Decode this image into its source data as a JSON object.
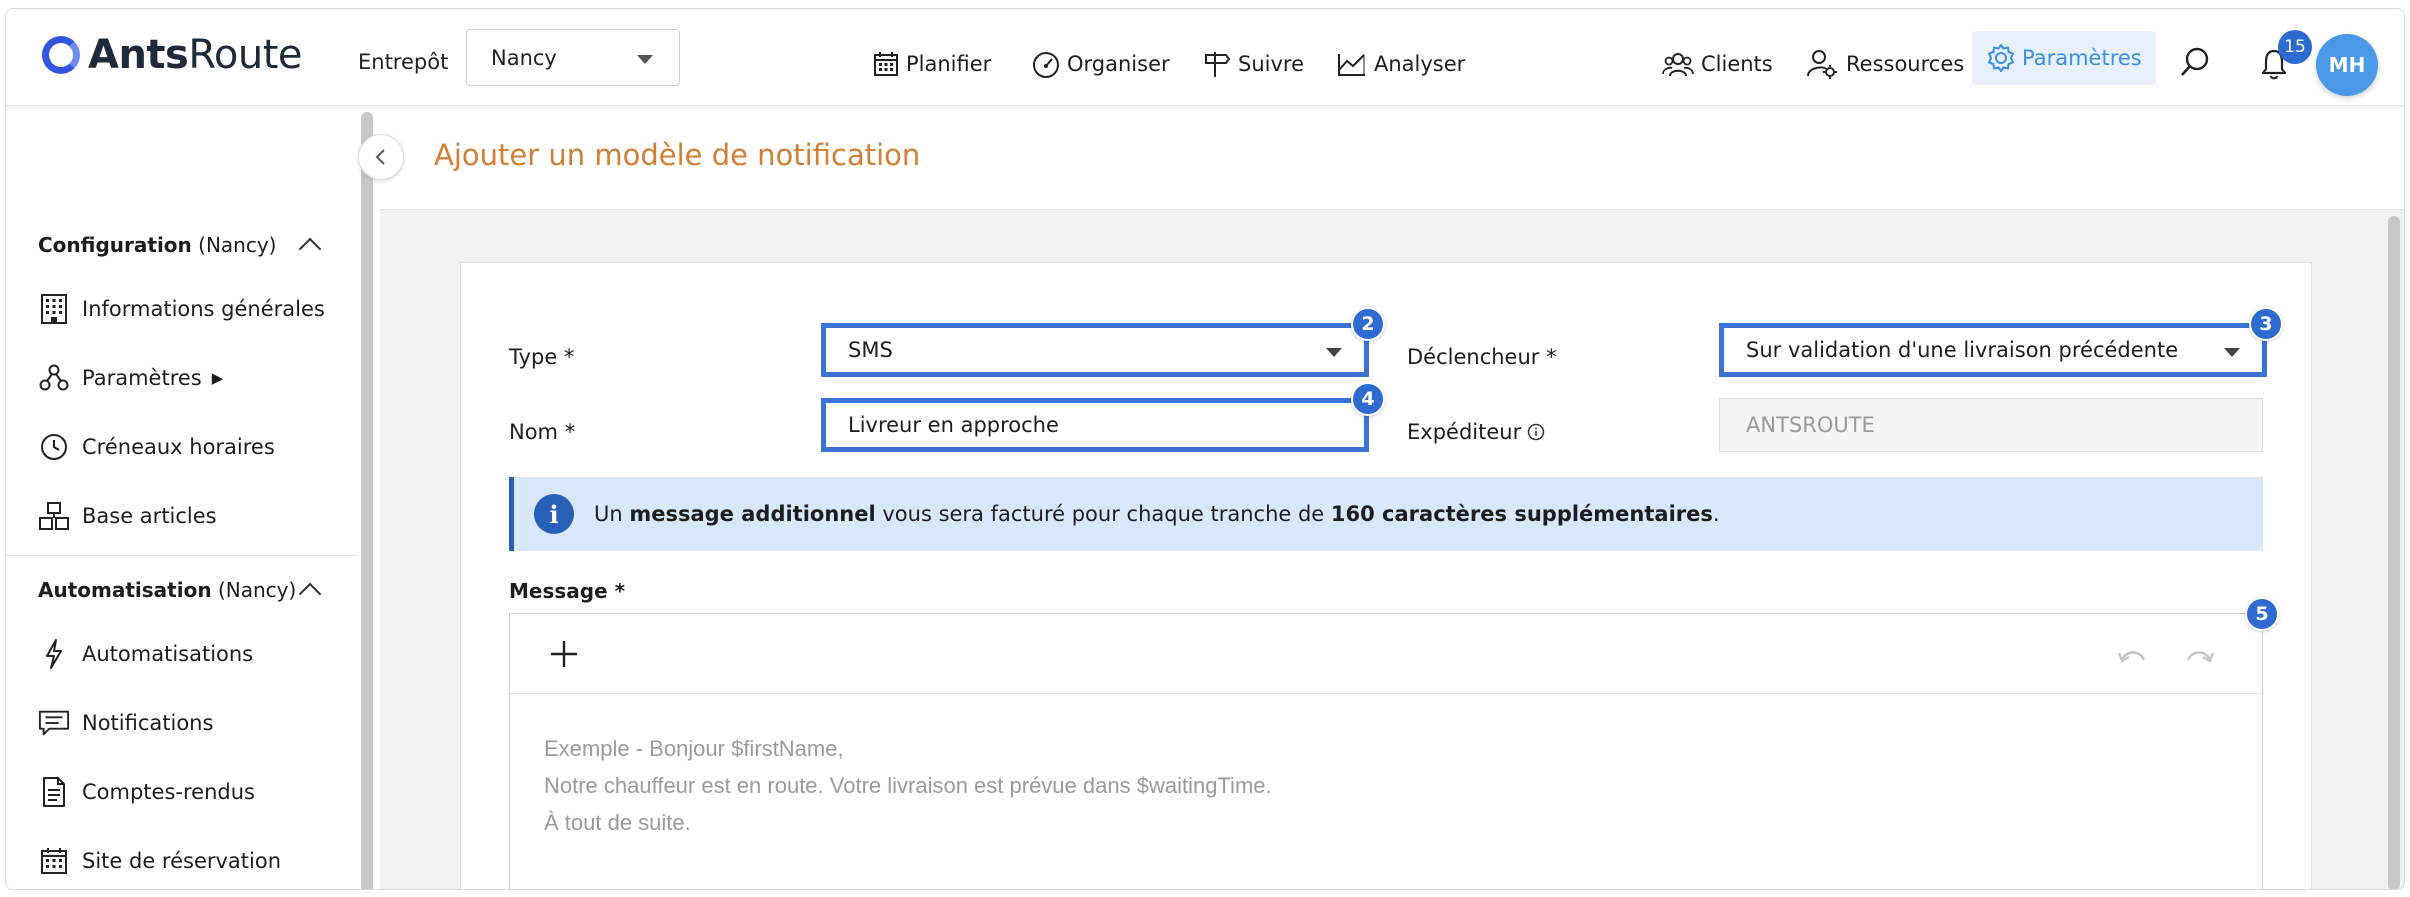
{
  "app": {
    "logo_bold": "Ants",
    "logo_light": "Route",
    "warehouse_label": "Entrepôt",
    "warehouse_value": "Nancy"
  },
  "nav": {
    "planifier": "Planifier",
    "organiser": "Organiser",
    "suivre": "Suivre",
    "analyser": "Analyser",
    "clients": "Clients",
    "ressources": "Ressources",
    "parametres": "Paramètres",
    "notif_count": "15",
    "avatar_initials": "MH",
    "accent": "#3a8ee8"
  },
  "sidebar": {
    "config_title": "Configuration",
    "config_scope": "(Nancy)",
    "items_config": [
      {
        "label": "Informations générales",
        "icon": "building-icon"
      },
      {
        "label": "Paramètres",
        "icon": "settings-tree-icon",
        "suffix": "▶"
      },
      {
        "label": "Créneaux horaires",
        "icon": "clock-icon"
      },
      {
        "label": "Base articles",
        "icon": "boxes-icon"
      }
    ],
    "auto_title": "Automatisation",
    "auto_scope": "(Nancy)",
    "items_auto": [
      {
        "label": "Automatisations",
        "icon": "lightning-icon"
      },
      {
        "label": "Notifications",
        "icon": "message-icon"
      },
      {
        "label": "Comptes-rendus",
        "icon": "document-icon"
      },
      {
        "label": "Site de réservation",
        "icon": "calendar-icon"
      }
    ]
  },
  "page": {
    "title": "Ajouter un modèle de notification"
  },
  "form": {
    "type_label": "Type *",
    "type_value": "SMS",
    "trigger_label": "Déclencheur *",
    "trigger_value": "Sur validation d'une livraison précédente",
    "name_label": "Nom *",
    "name_value": "Livreur en approche",
    "sender_label": "Expéditeur",
    "sender_value": "ANTSROUTE",
    "step_type": "2",
    "step_trigger": "3",
    "step_name": "4",
    "step_message": "5"
  },
  "banner": {
    "part1": "Un ",
    "bold1": "message additionnel",
    "part2": " vous sera facturé pour chaque tranche de ",
    "bold2": "160 caractères supplémentaires",
    "part3": "."
  },
  "message": {
    "label": "Message *",
    "placeholder_line1": "Exemple - Bonjour $firstName,",
    "placeholder_line2": "Notre chauffeur est en route. Votre livraison est prévue dans $waitingTime.",
    "placeholder_line3": "À tout de suite."
  }
}
